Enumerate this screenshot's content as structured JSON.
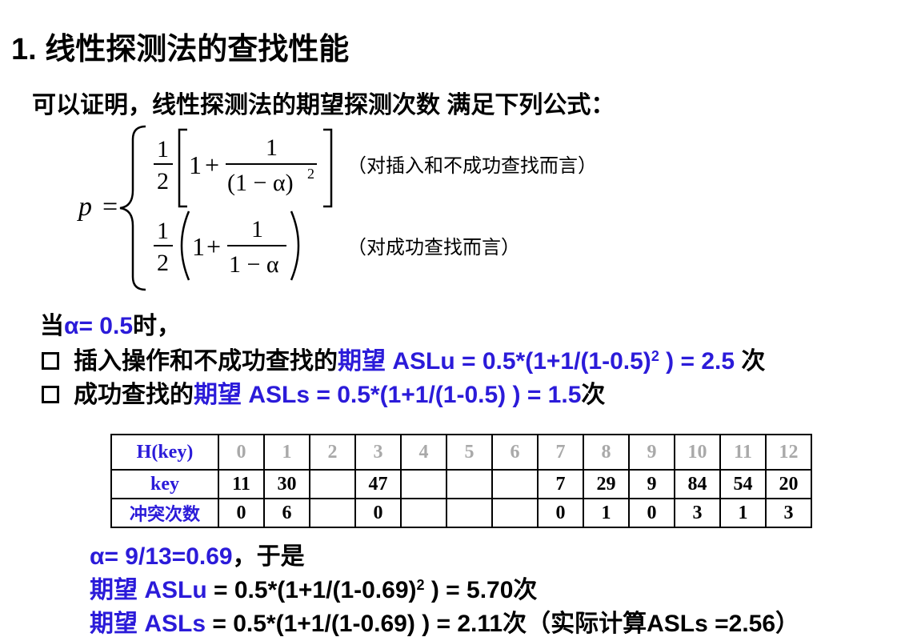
{
  "title": "1.  线性探测法的查找性能",
  "intro": "可以证明，线性探测法的期望探测次数 满足下列公式：",
  "formula": {
    "p": "p",
    "eq": "=",
    "half_num": "1",
    "half_den": "2",
    "one": "1",
    "plus": "+",
    "frac_num": "1",
    "frac_den1": "(1 − α)",
    "sq": "2",
    "frac_den2": "1 − α",
    "note1": "（对插入和不成功查找而言）",
    "note2": "（对成功查找而言）"
  },
  "alpha_line": {
    "prefix": "当",
    "value": "α= 0.5",
    "suffix": "时，"
  },
  "bullet1": {
    "text": "插入操作和不成功查找的",
    "label": "期望",
    "expr": " ASLu = 0.5*(1+1/(1-0.5)",
    "sup": "2",
    "expr2": " ) = 2.5",
    "unit": " 次"
  },
  "bullet2": {
    "text": "成功查找的",
    "label": "期望",
    "expr": " ASLs = 0.5*(1+1/(1-0.5) ) = 1.5",
    "unit": "次"
  },
  "table": {
    "row_labels": [
      "H(key)",
      "key",
      "冲突次数"
    ],
    "indices": [
      "0",
      "1",
      "2",
      "3",
      "4",
      "5",
      "6",
      "7",
      "8",
      "9",
      "10",
      "11",
      "12"
    ],
    "keys": [
      "11",
      "30",
      "",
      "47",
      "",
      "",
      "",
      "7",
      "29",
      "9",
      "84",
      "54",
      "20"
    ],
    "collisions": [
      "0",
      "6",
      "",
      "0",
      "",
      "",
      "",
      "0",
      "1",
      "0",
      "3",
      "1",
      "3"
    ]
  },
  "alpha2": {
    "value": "α= 9/13=0.69",
    "suffix": "，于是"
  },
  "aslu2": {
    "label": "期望 ASLu",
    "expr": " = 0.5*(1+1/(1-0.69)",
    "sup": "2",
    "expr2": " ) = 5.70",
    "unit": "次"
  },
  "asls2": {
    "label": "期望 ASLs",
    "expr": "  = 0.5*(1+1/(1-0.69) ) = 2.11",
    "unit": "次",
    "paren": "（实际计算",
    "note": "ASLs =2.56",
    "close": "）"
  }
}
